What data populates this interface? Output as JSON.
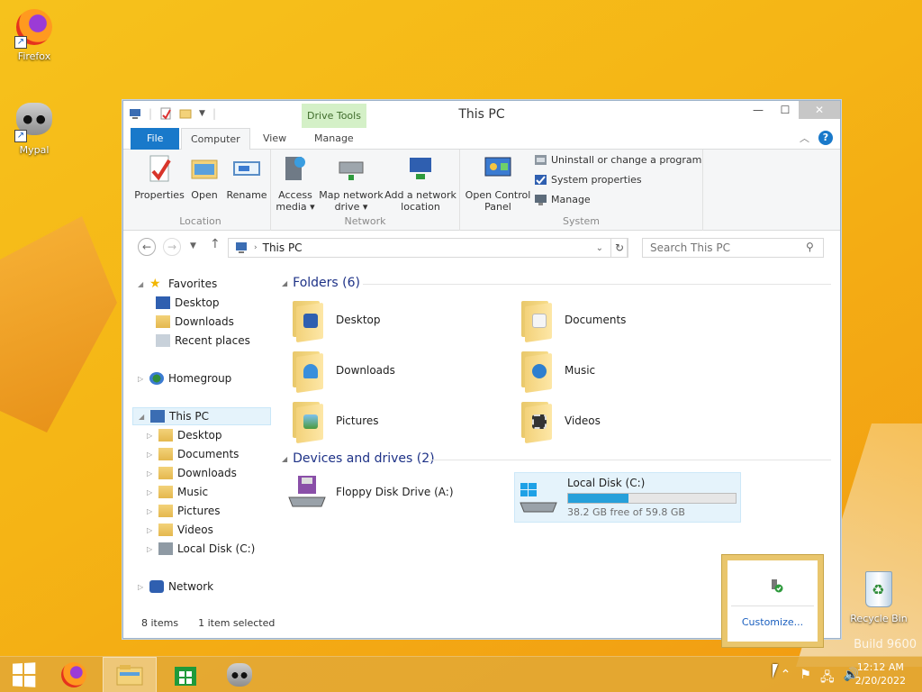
{
  "desktop": {
    "icons": [
      {
        "label": "Firefox"
      },
      {
        "label": "Mypal"
      },
      {
        "label": "Recycle Bin"
      }
    ],
    "watermark": "Build 9600"
  },
  "window": {
    "title": "This PC",
    "contextual_tab": "Drive Tools",
    "controls": {
      "minimize": "—",
      "maximize": "☐",
      "close": "✕"
    }
  },
  "ribbon": {
    "tabs": [
      "File",
      "Computer",
      "View",
      "Manage"
    ],
    "active_tab": "Computer",
    "groups": {
      "location": {
        "label": "Location",
        "buttons": [
          "Properties",
          "Open",
          "Rename"
        ]
      },
      "network": {
        "label": "Network",
        "buttons": [
          {
            "line1": "Access",
            "line2": "media ▾"
          },
          {
            "line1": "Map network",
            "line2": "drive ▾"
          },
          {
            "line1": "Add a network",
            "line2": "location"
          }
        ]
      },
      "system": {
        "label": "System",
        "big_button": {
          "line1": "Open Control",
          "line2": "Panel"
        },
        "small_buttons": [
          "Uninstall or change a program",
          "System properties",
          "Manage"
        ]
      }
    }
  },
  "navigation": {
    "address": "This PC",
    "search_placeholder": "Search This PC"
  },
  "nav_pane": {
    "favorites": {
      "label": "Favorites",
      "items": [
        "Desktop",
        "Downloads",
        "Recent places"
      ]
    },
    "homegroup": "Homegroup",
    "this_pc": {
      "label": "This PC",
      "items": [
        "Desktop",
        "Documents",
        "Downloads",
        "Music",
        "Pictures",
        "Videos",
        "Local Disk (C:)"
      ]
    },
    "network": "Network"
  },
  "content": {
    "folders_header": "Folders (6)",
    "folders": [
      "Desktop",
      "Documents",
      "Downloads",
      "Music",
      "Pictures",
      "Videos"
    ],
    "devices_header": "Devices and drives (2)",
    "drives": [
      {
        "name": "Floppy Disk Drive (A:)"
      },
      {
        "name": "Local Disk (C:)",
        "free_text": "38.2 GB free of 59.8 GB",
        "used_fraction": 0.36
      }
    ]
  },
  "status": {
    "items": "8 items",
    "selected": "1 item selected"
  },
  "flyout": {
    "customize": "Customize..."
  },
  "taskbar": {
    "time": "12:12 AM",
    "date": "2/20/2022"
  }
}
